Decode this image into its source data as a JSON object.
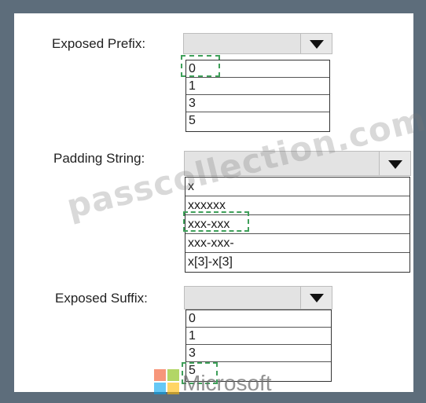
{
  "fields": {
    "exposed_prefix": {
      "label": "Exposed Prefix:",
      "options": [
        "0",
        "1",
        "3",
        "5"
      ],
      "selected": "0"
    },
    "padding_string": {
      "label": "Padding String:",
      "options": [
        "x",
        "xxxxxx",
        "xxx-xxx",
        "xxx-xxx-",
        "x[3]-x[3]"
      ],
      "selected": "xxx-xxx"
    },
    "exposed_suffix": {
      "label": "Exposed Suffix:",
      "options": [
        "0",
        "1",
        "3",
        "5"
      ],
      "selected": "5"
    }
  },
  "watermark": {
    "text": "passcollection.com"
  },
  "logo": {
    "text": "Microsoft",
    "colors": [
      "#f25022",
      "#7fba00",
      "#00a4ef",
      "#ffb900"
    ]
  },
  "icons": {
    "dropdown": "caret-down-icon"
  },
  "colors": {
    "frame": "#5d6d7b",
    "selection_marker": "#3fa05a"
  }
}
